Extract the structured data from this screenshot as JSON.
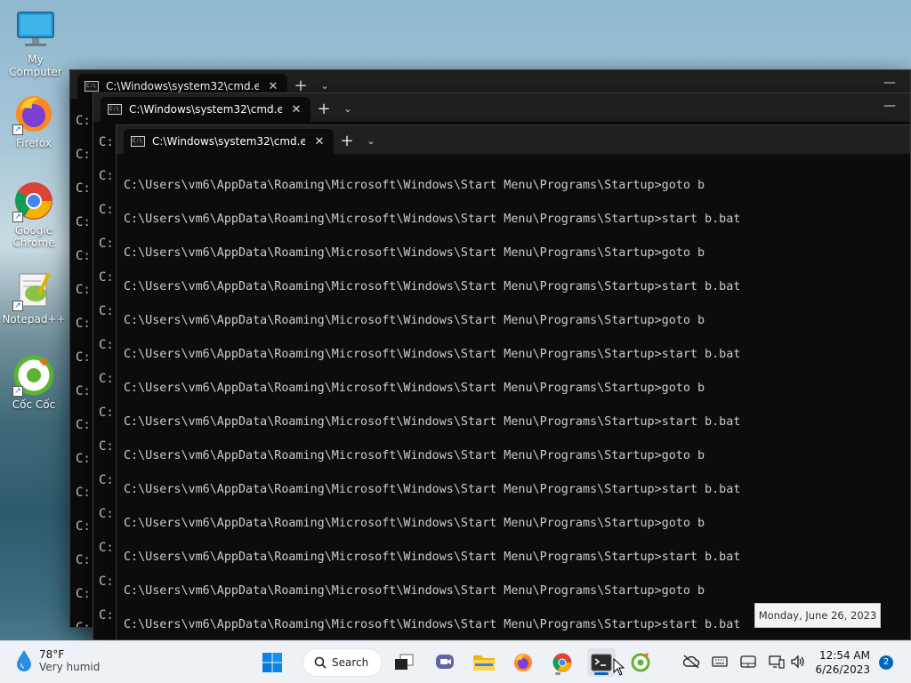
{
  "desktop": {
    "icons": [
      {
        "label": "My Computer",
        "icon": "monitor-icon"
      },
      {
        "label": "Firefox",
        "icon": "firefox-icon"
      },
      {
        "label": "Google Chrome",
        "icon": "chrome-icon"
      },
      {
        "label": "Notepad++",
        "icon": "notepadpp-icon"
      },
      {
        "label": "Cốc Cốc",
        "icon": "coccoc-icon"
      }
    ]
  },
  "windows": [
    {
      "tab_title": "C:\\Windows\\system32\\cmd.e:",
      "stub_char": "C:"
    },
    {
      "tab_title": "C:\\Windows\\system32\\cmd.e:",
      "stub_char": "C:"
    },
    {
      "tab_title": "C:\\Windows\\system32\\cmd.e:"
    }
  ],
  "tabbar": {
    "close_glyph": "✕",
    "new_tab_glyph": "+",
    "dropdown_glyph": "⌄",
    "minimize_glyph": "—"
  },
  "terminal": {
    "lines": [
      "C:\\Users\\vm6\\AppData\\Roaming\\Microsoft\\Windows\\Start Menu\\Programs\\Startup>goto b",
      "C:\\Users\\vm6\\AppData\\Roaming\\Microsoft\\Windows\\Start Menu\\Programs\\Startup>start b.bat",
      "C:\\Users\\vm6\\AppData\\Roaming\\Microsoft\\Windows\\Start Menu\\Programs\\Startup>goto b",
      "C:\\Users\\vm6\\AppData\\Roaming\\Microsoft\\Windows\\Start Menu\\Programs\\Startup>start b.bat",
      "C:\\Users\\vm6\\AppData\\Roaming\\Microsoft\\Windows\\Start Menu\\Programs\\Startup>goto b",
      "C:\\Users\\vm6\\AppData\\Roaming\\Microsoft\\Windows\\Start Menu\\Programs\\Startup>start b.bat",
      "C:\\Users\\vm6\\AppData\\Roaming\\Microsoft\\Windows\\Start Menu\\Programs\\Startup>goto b",
      "C:\\Users\\vm6\\AppData\\Roaming\\Microsoft\\Windows\\Start Menu\\Programs\\Startup>start b.bat",
      "C:\\Users\\vm6\\AppData\\Roaming\\Microsoft\\Windows\\Start Menu\\Programs\\Startup>goto b",
      "C:\\Users\\vm6\\AppData\\Roaming\\Microsoft\\Windows\\Start Menu\\Programs\\Startup>start b.bat",
      "C:\\Users\\vm6\\AppData\\Roaming\\Microsoft\\Windows\\Start Menu\\Programs\\Startup>goto b",
      "C:\\Users\\vm6\\AppData\\Roaming\\Microsoft\\Windows\\Start Menu\\Programs\\Startup>start b.bat",
      "C:\\Users\\vm6\\AppData\\Roaming\\Microsoft\\Windows\\Start Menu\\Programs\\Startup>goto b",
      "C:\\Users\\vm6\\AppData\\Roaming\\Microsoft\\Windows\\Start Menu\\Programs\\Startup>start b.bat"
    ]
  },
  "taskbar": {
    "weather": {
      "temp": "78°F",
      "condition": "Very humid"
    },
    "search_label": "Search",
    "clock": {
      "time": "12:54 AM",
      "date": "6/26/2023"
    },
    "notification_count": "2",
    "tooltip": "Monday, June 26, 2023"
  },
  "colors": {
    "accent": "#0067c0",
    "terminal_bg": "#0c0c0c",
    "terminal_fg": "#cccccc",
    "tabbar_bg": "#202020"
  }
}
